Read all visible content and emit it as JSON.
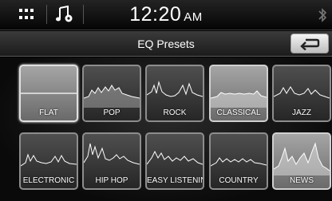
{
  "status_bar": {
    "menu_icon": "grid-menu-icon",
    "music_icon": "music-settings-icon",
    "time": "12:20",
    "ampm": "AM",
    "bluetooth_icon": "bluetooth-icon"
  },
  "header": {
    "title": "EQ Presets",
    "back_icon": "back-arrow-icon"
  },
  "presets": [
    {
      "label": "FLAT",
      "selected": true
    },
    {
      "label": "POP"
    },
    {
      "label": "ROCK"
    },
    {
      "label": "CLASSICAL"
    },
    {
      "label": "JAZZ"
    },
    {
      "label": "ELECTRONIC"
    },
    {
      "label": "HIP HOP"
    },
    {
      "label": "EASY LISTENING"
    },
    {
      "label": "COUNTRY"
    },
    {
      "label": "NEWS"
    }
  ]
}
